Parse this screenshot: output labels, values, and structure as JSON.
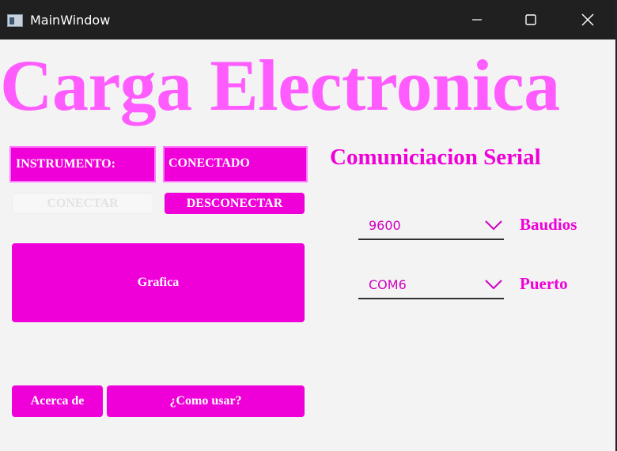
{
  "window": {
    "title": "MainWindow",
    "controls": {
      "minimize_icon": "minimize-icon",
      "maximize_icon": "maximize-icon",
      "close_icon": "close-icon"
    }
  },
  "header": {
    "title": "Carga Electronica"
  },
  "instrument": {
    "label": "INSTRUMENTO:",
    "status": "CONECTADO",
    "connect_button": "CONECTAR",
    "disconnect_button": "DESCONECTAR"
  },
  "actions": {
    "graph_button": "Grafica",
    "about_button": "Acerca de",
    "howto_button": "¿Como usar?"
  },
  "serial": {
    "title": "Comuniciacion Serial",
    "baud": {
      "value": "9600",
      "label": "Baudios"
    },
    "port": {
      "value": "COM6",
      "label": "Puerto"
    }
  },
  "colors": {
    "accent": "#f000d8",
    "headline": "#ff5cff",
    "titlebar": "#202020",
    "background": "#f3f3f3"
  }
}
